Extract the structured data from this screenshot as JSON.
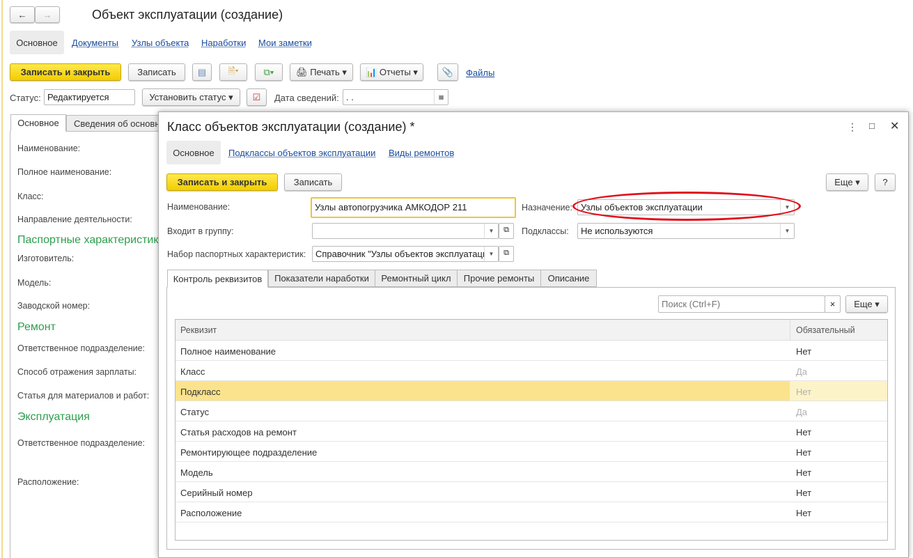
{
  "main": {
    "title": "Объект эксплуатации (создание)",
    "nav": [
      "Основное",
      "Документы",
      "Узлы объекта",
      "Наработки",
      "Мои заметки"
    ],
    "toolbar": {
      "save_close": "Записать и закрыть",
      "save": "Записать",
      "print": "Печать",
      "reports": "Отчеты",
      "files": "Файлы"
    },
    "status_label": "Статус:",
    "status_value": "Редактируется",
    "set_status": "Установить статус",
    "date_label": "Дата сведений:",
    "date_value": " .  .",
    "tabs": [
      "Основное",
      "Сведения об основн"
    ],
    "fields": [
      "Наименование:",
      "Полное наименование:",
      "Класс:",
      "Направление деятельности:",
      "Изготовитель:",
      "Модель:",
      "Заводской номер:",
      "Ответственное подразделение:",
      "Способ отражения зарплаты:",
      "Статья для материалов и работ:",
      "Ответственное подразделение:",
      "Расположение:"
    ],
    "groups": [
      "Паспортные характеристики",
      "Ремонт",
      "Эксплуатация"
    ]
  },
  "dialog": {
    "title": "Класс объектов эксплуатации (создание) *",
    "nav": [
      "Основное",
      "Подклассы объектов эксплуатации",
      "Виды ремонтов"
    ],
    "save_close": "Записать и закрыть",
    "save": "Записать",
    "more": "Еще",
    "help": "?",
    "name_label": "Наименование:",
    "name_value": "Узлы автопогрузчика АМКОДОР 211",
    "purpose_label": "Назначение:",
    "purpose_value": "Узлы объектов эксплуатации",
    "group_label": "Входит в группу:",
    "group_value": "",
    "subclasses_label": "Подклассы:",
    "subclasses_value": "Не используются",
    "passport_label": "Набор паспортных характеристик:",
    "passport_value": "Справочник \"Узлы объектов эксплуатаци",
    "tabs": [
      "Контроль реквизитов",
      "Показатели наработки",
      "Ремонтный цикл",
      "Прочие ремонты",
      "Описание"
    ],
    "search_placeholder": "Поиск (Ctrl+F)",
    "table_more": "Еще",
    "columns": [
      "Реквизит",
      "Обязательный"
    ],
    "rows": [
      {
        "name": "Полное наименование",
        "required": "Нет",
        "disabled": false
      },
      {
        "name": "Класс",
        "required": "Да",
        "disabled": true
      },
      {
        "name": "Подкласс",
        "required": "Нет",
        "disabled": true,
        "selected": true
      },
      {
        "name": "Статус",
        "required": "Да",
        "disabled": true
      },
      {
        "name": "Статья расходов на ремонт",
        "required": "Нет",
        "disabled": false
      },
      {
        "name": "Ремонтирующее подразделение",
        "required": "Нет",
        "disabled": false
      },
      {
        "name": "Модель",
        "required": "Нет",
        "disabled": false
      },
      {
        "name": "Серийный номер",
        "required": "Нет",
        "disabled": false
      },
      {
        "name": "Расположение",
        "required": "Нет",
        "disabled": false
      }
    ]
  },
  "colors": {
    "accent_yellow": "#f2cd00",
    "link": "#1a4c9c",
    "group_green": "#2e9e4e",
    "selected_row": "#fbe38d",
    "highlight_ellipse": "#e0101a"
  }
}
